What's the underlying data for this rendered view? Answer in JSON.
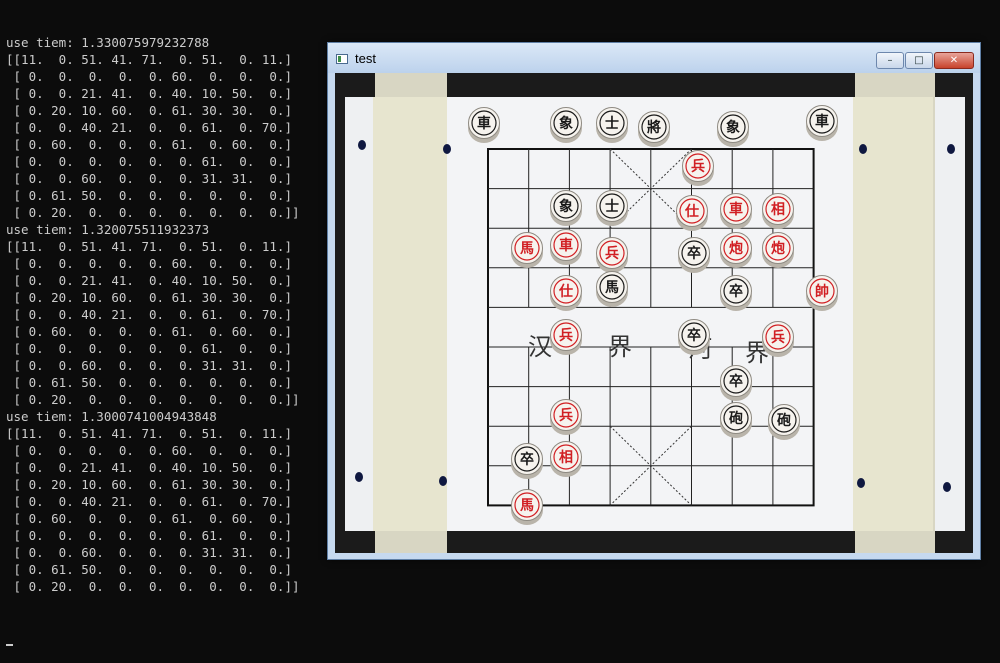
{
  "terminal": {
    "lines": [
      "use tiem: 1.330075979232788",
      "[[11.  0. 51. 41. 71.  0. 51.  0. 11.]",
      " [ 0.  0.  0.  0.  0. 60.  0.  0.  0.]",
      " [ 0.  0. 21. 41.  0. 40. 10. 50.  0.]",
      " [ 0. 20. 10. 60.  0. 61. 30. 30.  0.]",
      " [ 0.  0. 40. 21.  0.  0. 61.  0. 70.]",
      " [ 0. 60.  0.  0.  0. 61.  0. 60.  0.]",
      " [ 0.  0.  0.  0.  0.  0. 61.  0.  0.]",
      " [ 0.  0. 60.  0.  0.  0. 31. 31.  0.]",
      " [ 0. 61. 50.  0.  0.  0.  0.  0.  0.]",
      " [ 0. 20.  0.  0.  0.  0.  0.  0.  0.]]",
      "use tiem: 1.320075511932373",
      "[[11.  0. 51. 41. 71.  0. 51.  0. 11.]",
      " [ 0.  0.  0.  0.  0. 60.  0.  0.  0.]",
      " [ 0.  0. 21. 41.  0. 40. 10. 50.  0.]",
      " [ 0. 20. 10. 60.  0. 61. 30. 30.  0.]",
      " [ 0.  0. 40. 21.  0.  0. 61.  0. 70.]",
      " [ 0. 60.  0.  0.  0. 61.  0. 60.  0.]",
      " [ 0.  0.  0.  0.  0.  0. 61.  0.  0.]",
      " [ 0.  0. 60.  0.  0.  0. 31. 31.  0.]",
      " [ 0. 61. 50.  0.  0.  0.  0.  0.  0.]",
      " [ 0. 20.  0.  0.  0.  0.  0.  0.  0.]]",
      "use tiem: 1.3000741004943848",
      "[[11.  0. 51. 41. 71.  0. 51.  0. 11.]",
      " [ 0.  0.  0.  0.  0. 60.  0.  0.  0.]",
      " [ 0.  0. 21. 41.  0. 40. 10. 50.  0.]",
      " [ 0. 20. 10. 60.  0. 61. 30. 30.  0.]",
      " [ 0.  0. 40. 21.  0.  0. 61.  0. 70.]",
      " [ 0. 60.  0.  0.  0. 61.  0. 60.  0.]",
      " [ 0.  0.  0.  0.  0.  0. 61.  0.  0.]",
      " [ 0.  0. 60.  0.  0.  0. 31. 31.  0.]",
      " [ 0. 61. 50.  0.  0.  0.  0.  0.  0.]",
      " [ 0. 20.  0.  0.  0.  0.  0.  0.  0.]]"
    ]
  },
  "window": {
    "title": "test",
    "buttons": {
      "minimize": "–",
      "maximize": "□",
      "close": "✕"
    }
  },
  "board": {
    "river_text": [
      "汉",
      "界",
      "河",
      "界"
    ],
    "pieces": [
      {
        "color": "black",
        "label": "車"
      },
      {
        "color": "black",
        "label": "象"
      },
      {
        "color": "black",
        "label": "士"
      },
      {
        "color": "black",
        "label": "將"
      },
      {
        "color": "black",
        "label": "象"
      },
      {
        "color": "black",
        "label": "車"
      },
      {
        "color": "red",
        "label": "兵"
      },
      {
        "color": "black",
        "label": "象"
      },
      {
        "color": "black",
        "label": "士"
      },
      {
        "color": "red",
        "label": "仕"
      },
      {
        "color": "red",
        "label": "車"
      },
      {
        "color": "red",
        "label": "相"
      },
      {
        "color": "red",
        "label": "馬"
      },
      {
        "color": "red",
        "label": "車"
      },
      {
        "color": "red",
        "label": "兵"
      },
      {
        "color": "black",
        "label": "卒"
      },
      {
        "color": "red",
        "label": "炮"
      },
      {
        "color": "red",
        "label": "炮"
      },
      {
        "color": "red",
        "label": "仕"
      },
      {
        "color": "black",
        "label": "馬"
      },
      {
        "color": "black",
        "label": "卒"
      },
      {
        "color": "red",
        "label": "帥"
      },
      {
        "color": "red",
        "label": "兵"
      },
      {
        "color": "black",
        "label": "卒"
      },
      {
        "color": "red",
        "label": "兵"
      },
      {
        "color": "black",
        "label": "卒"
      },
      {
        "color": "black",
        "label": "砲"
      },
      {
        "color": "black",
        "label": "砲"
      },
      {
        "color": "red",
        "label": "兵"
      },
      {
        "color": "black",
        "label": "卒"
      },
      {
        "color": "red",
        "label": "相"
      },
      {
        "color": "red",
        "label": "馬"
      }
    ]
  }
}
